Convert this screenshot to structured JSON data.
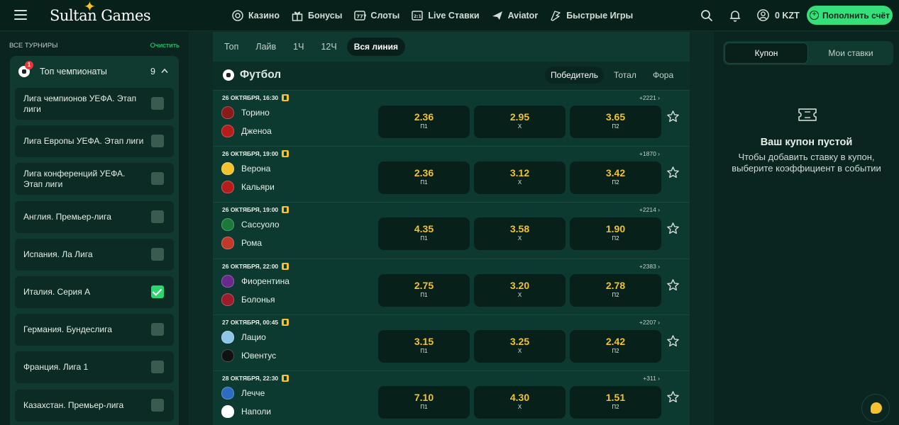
{
  "header": {
    "logo": "Sultan Games",
    "nav": [
      {
        "label": "Казино",
        "icon": "casino-chip-icon"
      },
      {
        "label": "Бонусы",
        "icon": "gift-icon"
      },
      {
        "label": "Слоты",
        "icon": "slots-icon"
      },
      {
        "label": "Live Ставки",
        "icon": "live-bets-icon"
      },
      {
        "label": "Aviator",
        "icon": "plane-icon"
      },
      {
        "label": "Быстрые Игры",
        "icon": "fast-games-icon"
      }
    ],
    "balance": "0 KZT",
    "deposit_label": "Пополнить счёт"
  },
  "sidebar": {
    "heading": "Все турниры",
    "clear_label": "Очистить",
    "group": {
      "title": "Топ чемпионаты",
      "badge": "1",
      "count": "9"
    },
    "leagues": [
      {
        "name": "Лига чемпионов УЕФА. Этап лиги",
        "checked": false
      },
      {
        "name": "Лига Европы УЕФА. Этап лиги",
        "checked": false
      },
      {
        "name": "Лига конференций УЕФА. Этап лиги",
        "checked": false
      },
      {
        "name": "Англия. Премьер-лига",
        "checked": false
      },
      {
        "name": "Испания. Ла Лига",
        "checked": false
      },
      {
        "name": "Италия. Серия А",
        "checked": true
      },
      {
        "name": "Германия. Бундеслига",
        "checked": false
      },
      {
        "name": "Франция. Лига 1",
        "checked": false
      },
      {
        "name": "Казахстан. Премьер-лига",
        "checked": false
      }
    ]
  },
  "center": {
    "tabs": [
      "Топ",
      "Лайв",
      "1Ч",
      "12Ч",
      "Вся линия"
    ],
    "active_tab": "Вся линия",
    "sport": "Футбол",
    "markets": [
      "Победитель",
      "Тотал",
      "Фора"
    ],
    "active_market": "Победитель",
    "odd_labels": [
      "П1",
      "X",
      "П2"
    ],
    "events": [
      {
        "date": "26 октября, 16:30",
        "more": "+2221",
        "home": "Торино",
        "away": "Дженоа",
        "home_color": "#8b1a1a",
        "away_color": "#b71c1c",
        "odds": [
          "2.36",
          "2.95",
          "3.65"
        ]
      },
      {
        "date": "26 октября, 19:00",
        "more": "+1870",
        "home": "Верона",
        "away": "Кальяри",
        "home_color": "#f2c230",
        "away_color": "#b71c1c",
        "odds": [
          "2.36",
          "3.12",
          "3.42"
        ]
      },
      {
        "date": "26 октября, 19:00",
        "more": "+2214",
        "home": "Сассуоло",
        "away": "Рома",
        "home_color": "#1b7a3a",
        "away_color": "#c0392b",
        "odds": [
          "4.35",
          "3.58",
          "1.90"
        ]
      },
      {
        "date": "26 октября, 22:00",
        "more": "+2383",
        "home": "Фиорентина",
        "away": "Болонья",
        "home_color": "#6a2a8c",
        "away_color": "#9c1c2c",
        "odds": [
          "2.75",
          "3.20",
          "2.78"
        ]
      },
      {
        "date": "27 октября, 00:45",
        "more": "+2207",
        "home": "Лацио",
        "away": "Ювентус",
        "home_color": "#8ec6e8",
        "away_color": "#111111",
        "odds": [
          "3.15",
          "3.25",
          "2.42"
        ]
      },
      {
        "date": "28 октября, 22:30",
        "more": "+311",
        "home": "Лечче",
        "away": "Наполи",
        "home_color": "#2d6cc0",
        "away_color": "#ffffff",
        "odds": [
          "7.10",
          "4.30",
          "1.51"
        ]
      }
    ]
  },
  "right": {
    "tabs": [
      "Купон",
      "Мои ставки"
    ],
    "active_tab": "Купон",
    "empty_title": "Ваш купон пустой",
    "empty_text": "Чтобы добавить ставку в купон, выберите коэффициент в событии"
  }
}
